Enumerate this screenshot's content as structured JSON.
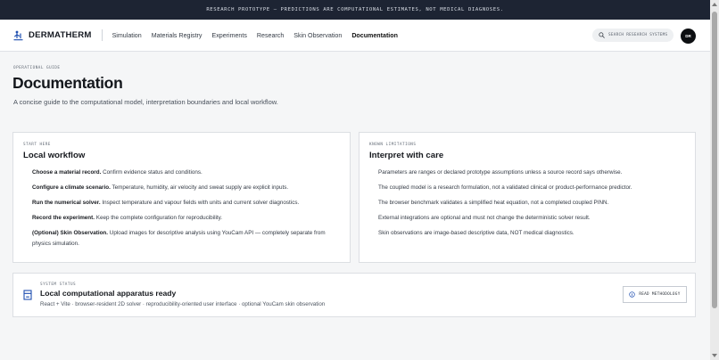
{
  "banner": {
    "text": "RESEARCH PROTOTYPE — PREDICTIONS ARE COMPUTATIONAL ESTIMATES, NOT MEDICAL DIAGNOSES."
  },
  "header": {
    "brand": "DERMATHERM",
    "nav": [
      {
        "label": "Simulation"
      },
      {
        "label": "Materials Registry"
      },
      {
        "label": "Experiments"
      },
      {
        "label": "Research"
      },
      {
        "label": "Skin Observation"
      },
      {
        "label": "Documentation",
        "active": true
      }
    ],
    "search_placeholder": "SEARCH RESEARCH SYSTEMS",
    "avatar_initials": "DR"
  },
  "page": {
    "eyebrow": "OPERATIONAL GUIDE",
    "title": "Documentation",
    "subtitle": "A concise guide to the computational model, interpretation boundaries and local workflow."
  },
  "workflow": {
    "eyebrow": "START HERE",
    "title": "Local workflow",
    "steps": [
      {
        "strong": "Choose a material record.",
        "text": " Confirm evidence status and conditions."
      },
      {
        "strong": "Configure a climate scenario.",
        "text": " Temperature, humidity, air velocity and sweat supply are explicit inputs."
      },
      {
        "strong": "Run the numerical solver.",
        "text": " Inspect temperature and vapour fields with units and current solver diagnostics."
      },
      {
        "strong": "Record the experiment.",
        "text": " Keep the complete configuration for reproducibility."
      },
      {
        "strong": "(Optional) Skin Observation.",
        "text": " Upload images for descriptive analysis using YouCam API — completely separate from physics simulation."
      }
    ]
  },
  "limitations": {
    "eyebrow": "KNOWN LIMITATIONS",
    "title": "Interpret with care",
    "items": [
      "Parameters are ranges or declared prototype assumptions unless a source record says otherwise.",
      "The coupled model is a research formulation, not a validated clinical or product-performance predictor.",
      "The browser benchmark validates a simplified heat equation, not a completed coupled PINN.",
      "External integrations are optional and must not change the deterministic solver result.",
      "Skin observations are image-based descriptive data, NOT medical diagnostics."
    ]
  },
  "status": {
    "eyebrow": "SYSTEM STATUS",
    "title": "Local computational apparatus ready",
    "description": "React + Vite · browser-resident 2D solver · reproducibility-oriented user interface · optional YouCam skin observation",
    "button_label": "READ METHODOLOGY"
  },
  "colors": {
    "banner_bg": "#1d2433",
    "page_bg": "#f5f6f7",
    "avatar_bg": "#0d0f12"
  },
  "icons": {
    "brand": "thermometer-body-icon",
    "search": "search-icon",
    "status": "apparatus-icon",
    "method": "info-icon"
  }
}
